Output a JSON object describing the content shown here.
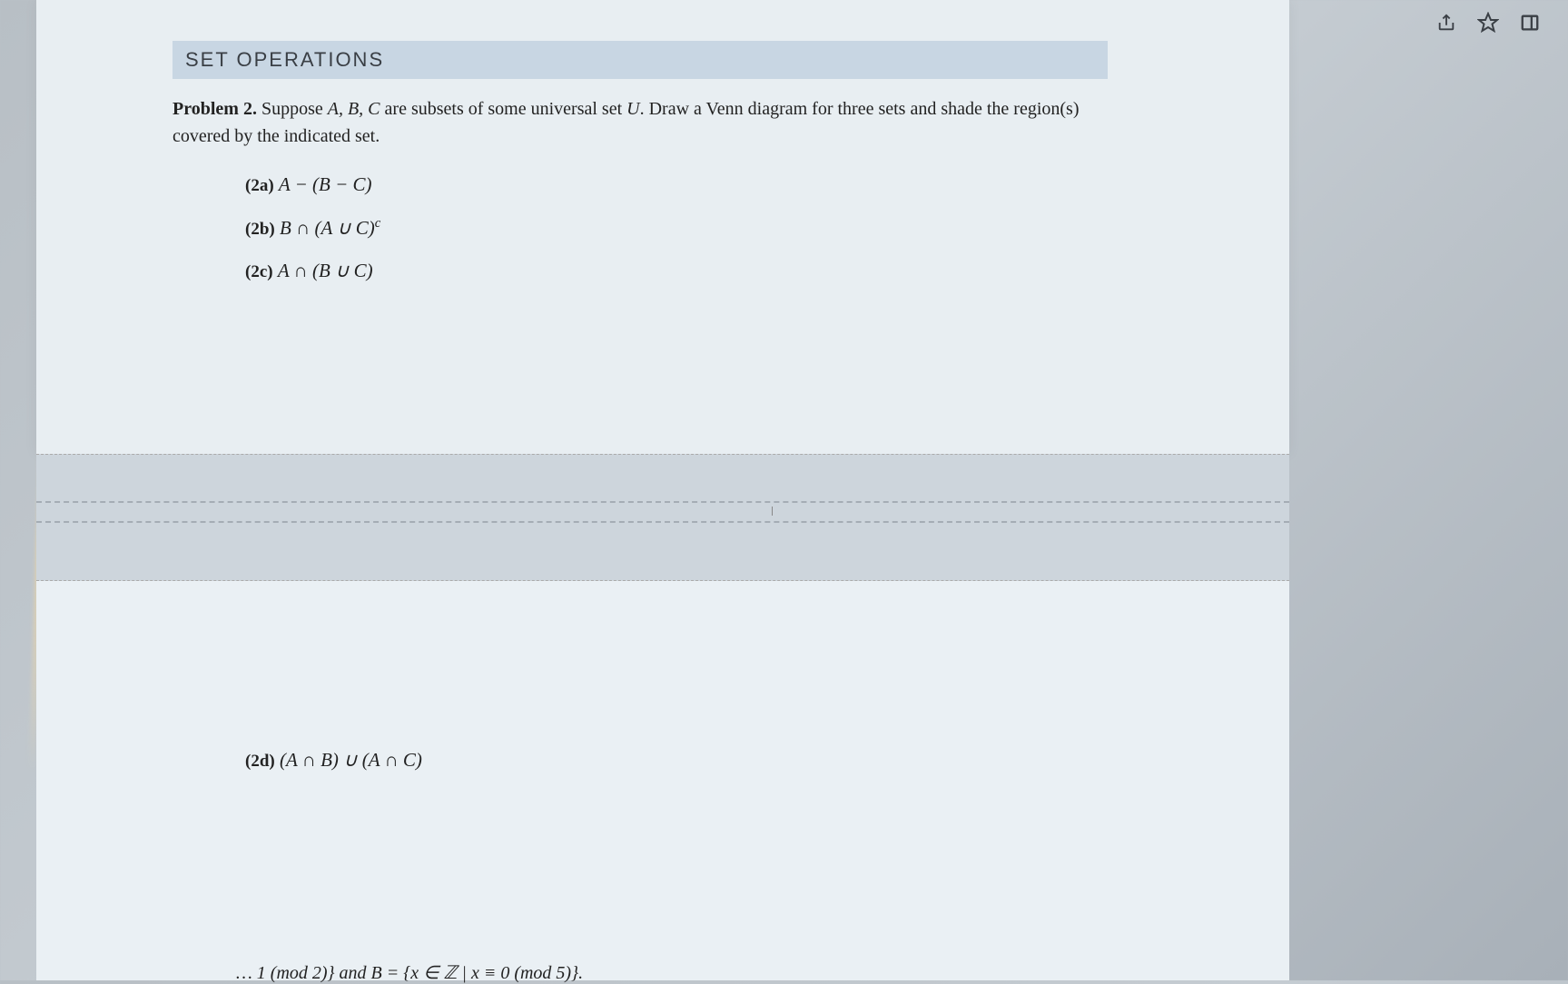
{
  "url_fragment": "…_id=1000009",
  "section_header": "SET OPERATIONS",
  "problem": {
    "label": "Problem 2.",
    "text_pre": "Suppose ",
    "sets": "A, B, C",
    "text_mid": " are subsets of some universal set ",
    "universal": "U",
    "text_post": ". Draw a Venn diagram for three sets and shade the region(s) covered by the indicated set."
  },
  "subproblems": {
    "a": {
      "label": "(2a)",
      "expr": "A − (B − C)"
    },
    "b": {
      "label": "(2b)",
      "expr": "B ∩ (A ∪ C)",
      "sup": "c"
    },
    "c": {
      "label": "(2c)",
      "expr": "A ∩ (B ∪ C)"
    },
    "d": {
      "label": "(2d)",
      "expr": "(A ∩ B) ∪ (A ∩ C)"
    }
  },
  "bottom_cut": "… 1 (mod 2)} and B = {x ∈ ℤ | x ≡ 0 (mod 5)}."
}
